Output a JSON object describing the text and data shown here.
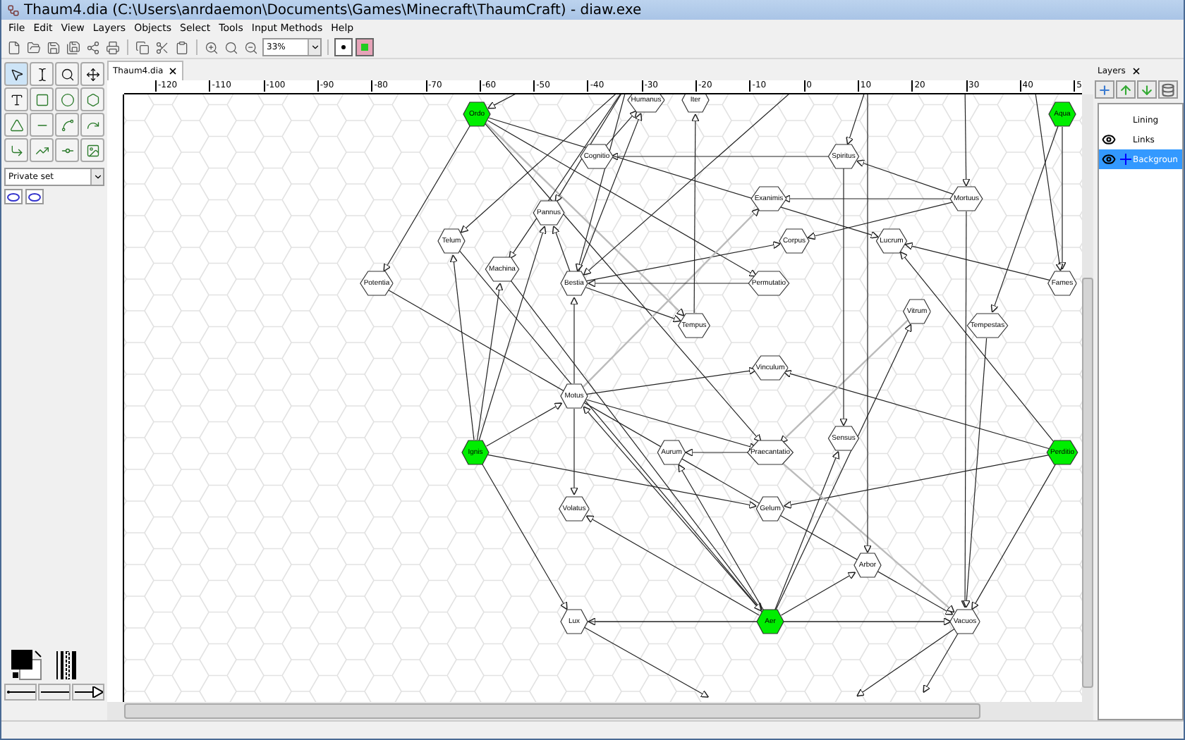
{
  "window": {
    "title": "Thaum4.dia (C:\\Users\\anrdaemon\\Documents\\Games\\Minecraft\\ThaumCraft) - diaw.exe"
  },
  "menu": [
    "File",
    "Edit",
    "View",
    "Layers",
    "Objects",
    "Select",
    "Tools",
    "Input Methods",
    "Help"
  ],
  "toolbar": {
    "zoom": "33%"
  },
  "toolbox": {
    "sheet": "Private set"
  },
  "document_tab": {
    "label": "Thaum4.dia"
  },
  "ruler": {
    "labels": [
      "-120",
      "-110",
      "-100",
      "-90",
      "-80",
      "-70",
      "-60",
      "-50",
      "-40",
      "-30",
      "-20",
      "-10",
      "0",
      "10",
      "20",
      "30",
      "40",
      "5"
    ]
  },
  "diagram": {
    "nodes": [
      {
        "label": "Ordo",
        "color": "#00ee00"
      },
      {
        "label": "Humanus",
        "color": "#ffffff"
      },
      {
        "label": "Iter",
        "color": "#ffffff"
      },
      {
        "label": "Aqua",
        "color": "#00ee00"
      },
      {
        "label": "Cognitio",
        "color": "#ffffff"
      },
      {
        "label": "Spiritus",
        "color": "#ffffff"
      },
      {
        "label": "Exanimis",
        "color": "#ffffff"
      },
      {
        "label": "Mortuus",
        "color": "#ffffff"
      },
      {
        "label": "Pannus",
        "color": "#ffffff"
      },
      {
        "label": "Telum",
        "color": "#ffffff"
      },
      {
        "label": "Corpus",
        "color": "#ffffff"
      },
      {
        "label": "Lucrum",
        "color": "#ffffff"
      },
      {
        "label": "Machina",
        "color": "#ffffff"
      },
      {
        "label": "Potentia",
        "color": "#ffffff"
      },
      {
        "label": "Bestia",
        "color": "#ffffff"
      },
      {
        "label": "Permutatio",
        "color": "#ffffff"
      },
      {
        "label": "Fames",
        "color": "#ffffff"
      },
      {
        "label": "Vitrum",
        "color": "#ffffff"
      },
      {
        "label": "Tempestas",
        "color": "#ffffff"
      },
      {
        "label": "Tempus",
        "color": "#ffffff"
      },
      {
        "label": "Vinculum",
        "color": "#ffffff"
      },
      {
        "label": "Motus",
        "color": "#ffffff"
      },
      {
        "label": "Ignis",
        "color": "#00ee00"
      },
      {
        "label": "Aurum",
        "color": "#ffffff"
      },
      {
        "label": "Praecantatio",
        "color": "#ffffff"
      },
      {
        "label": "Sensus",
        "color": "#ffffff"
      },
      {
        "label": "Perditio",
        "color": "#00ee00"
      },
      {
        "label": "Volatus",
        "color": "#ffffff"
      },
      {
        "label": "Gelum",
        "color": "#ffffff"
      },
      {
        "label": "Arbor",
        "color": "#ffffff"
      },
      {
        "label": "Lux",
        "color": "#ffffff"
      },
      {
        "label": "Aer",
        "color": "#00ee00"
      },
      {
        "label": "Vacuos",
        "color": "#ffffff"
      }
    ]
  },
  "layers": {
    "title": "Layers",
    "items": [
      {
        "name": "Lining",
        "visible": false,
        "selected": false
      },
      {
        "name": "Links",
        "visible": true,
        "selected": false
      },
      {
        "name": "Backgroun",
        "visible": true,
        "selected": true
      }
    ]
  }
}
